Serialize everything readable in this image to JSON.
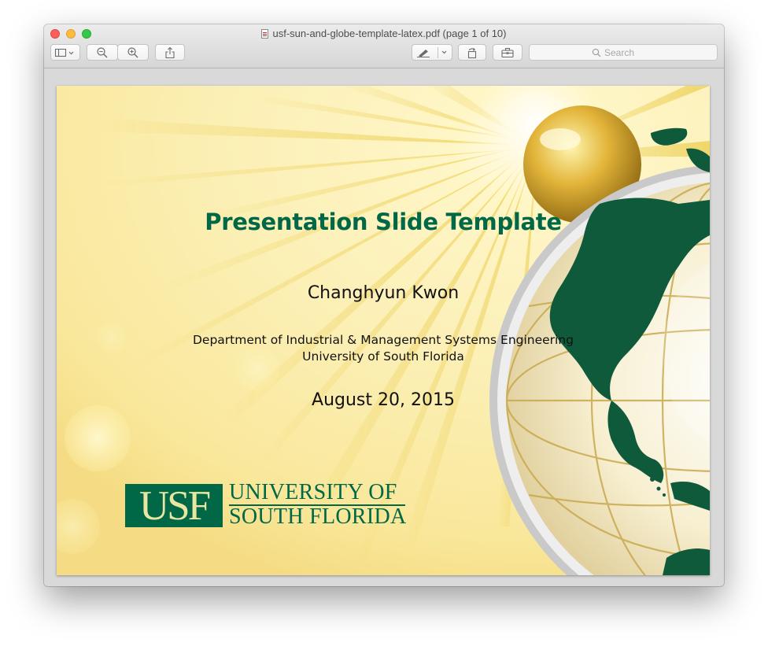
{
  "window": {
    "title": "usf-sun-and-globe-template-latex.pdf (page 1 of 10)",
    "document_icon": "pdf-document-icon"
  },
  "toolbar": {
    "buttons": [
      {
        "name": "sidebar-toggle-button",
        "icon": "sidebar-icon"
      },
      {
        "name": "zoom-out-button",
        "icon": "zoom-out-icon"
      },
      {
        "name": "zoom-in-button",
        "icon": "zoom-in-icon"
      },
      {
        "name": "share-button",
        "icon": "share-icon"
      },
      {
        "name": "markup-button",
        "icon": "pen-icon"
      },
      {
        "name": "rotate-button",
        "icon": "rotate-icon"
      },
      {
        "name": "toolbox-button",
        "icon": "toolbox-icon"
      }
    ],
    "search": {
      "placeholder": "Search",
      "value": ""
    }
  },
  "slide": {
    "title": "Presentation Slide Template",
    "author": "Changhyun Kwon",
    "department": "Department of Industrial & Management Systems Engineering",
    "university": "University of South Florida",
    "date": "August 20, 2015",
    "logo": {
      "abbr": "USF",
      "line1": "UNIVERSITY OF",
      "line2": "SOUTH FLORIDA"
    },
    "colors": {
      "usf_green": "#006747",
      "usf_gold": "#cfc493",
      "sun_yellow": "#f6e27a"
    }
  }
}
